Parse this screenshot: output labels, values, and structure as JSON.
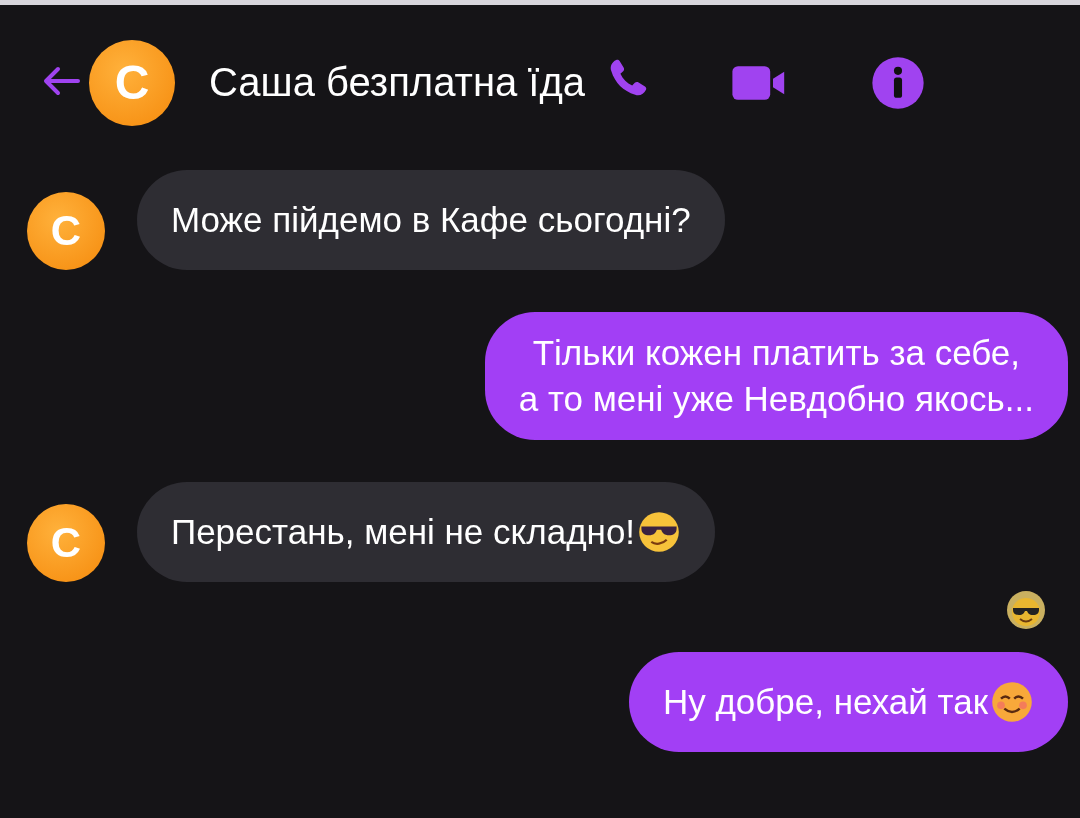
{
  "header": {
    "avatar_letter": "С",
    "title": "Саша безплатна їда"
  },
  "messages": [
    {
      "kind": "incoming",
      "avatar_letter": "С",
      "lines": [
        "Може пійдемо в Кафе сьогодні?"
      ]
    },
    {
      "kind": "outgoing",
      "lines": [
        "Тільки кожен платить за себе,",
        "а то мені уже Невдобно якось..."
      ]
    },
    {
      "kind": "incoming",
      "avatar_letter": "С",
      "lines": [
        "Перестань, мені не складно!"
      ],
      "emoji": {
        "kind": "sunglasses"
      }
    },
    {
      "kind": "seen"
    },
    {
      "kind": "outgoing",
      "lines": [
        "Ну добре, нехай так"
      ],
      "emoji": {
        "kind": "smile"
      }
    }
  ]
}
